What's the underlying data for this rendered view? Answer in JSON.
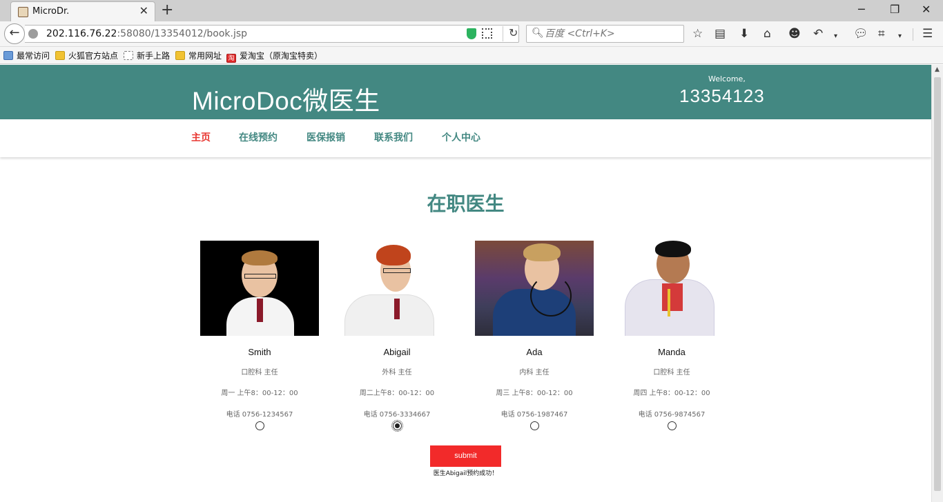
{
  "browser": {
    "tab_title": "MicroDr.",
    "url_host": "202.116.76.22",
    "url_rest": ":58080/13354012/book.jsp",
    "search_placeholder": "百度 <Ctrl+K>",
    "bookmarks": [
      "最常访问",
      "火狐官方站点",
      "新手上路",
      "常用网址",
      "爱淘宝（原淘宝特卖）"
    ]
  },
  "header": {
    "logo": "MicroDoc微医生",
    "welcome": "Welcome,",
    "username": "13354123"
  },
  "nav": {
    "items": [
      "主页",
      "在线预约",
      "医保报销",
      "联系我们",
      "个人中心"
    ]
  },
  "main": {
    "title": "在职医生",
    "doctors": [
      {
        "name": "Smith",
        "dept": "口腔科 主任",
        "hours": "周一 上午8：00-12：00",
        "phone": "电话 0756-1234567",
        "selected": false
      },
      {
        "name": "Abigail",
        "dept": "外科 主任",
        "hours": "周二上午8：00-12：00",
        "phone": "电话 0756-3334667",
        "selected": true
      },
      {
        "name": "Ada",
        "dept": "内科 主任",
        "hours": "周三 上午8：00-12：00",
        "phone": "电话 0756-1987467",
        "selected": false
      },
      {
        "name": "Manda",
        "dept": "口腔科 主任",
        "hours": "周四 上午8：00-12：00",
        "phone": "电话 0756-9874567",
        "selected": false
      }
    ],
    "submit_label": "submit",
    "success_message": "医生Abigail预约成功！"
  },
  "colors": {
    "brand": "#438882",
    "active_nav": "#e8352f",
    "submit": "#f22a2a"
  }
}
